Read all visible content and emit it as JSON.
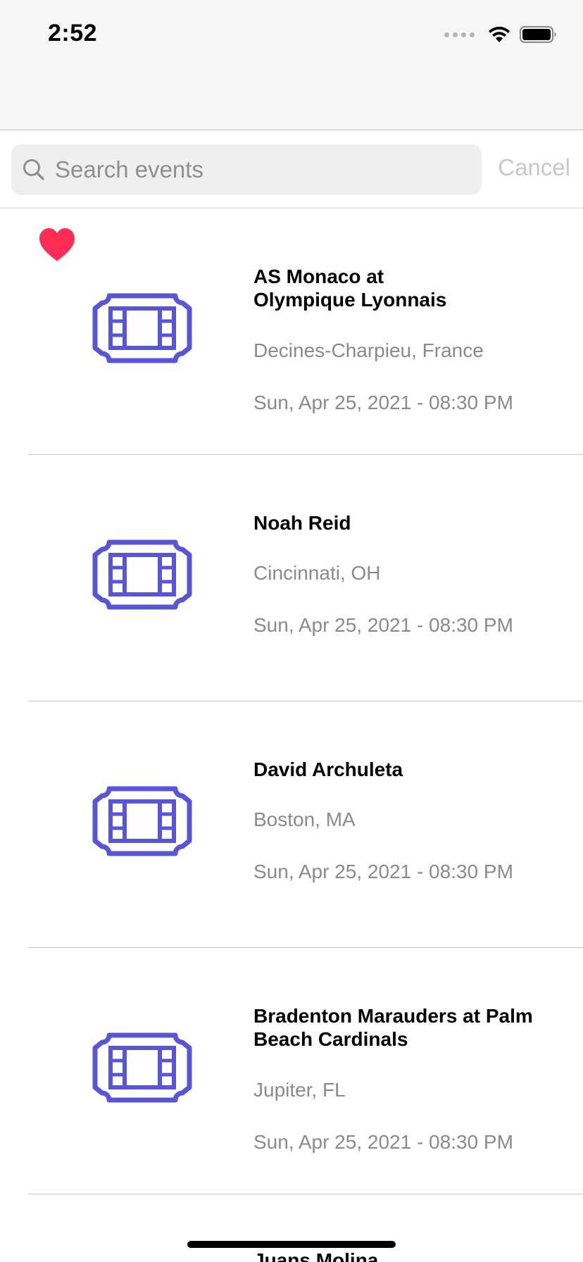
{
  "status_bar": {
    "time": "2:52"
  },
  "search": {
    "placeholder": "Search events",
    "value": "",
    "cancel_label": "Cancel"
  },
  "colors": {
    "accent": "#5856D6",
    "favorite": "#FF2D55"
  },
  "events": [
    {
      "title_line1": "AS Monaco at",
      "title_line2": "Olympique Lyonnais",
      "location": "Decines-Charpieu, France",
      "date": "Sun, Apr 25, 2021 - 08:30 PM",
      "favorited": true,
      "icon": "ticket-icon"
    },
    {
      "title_line1": "Noah Reid",
      "title_line2": "",
      "location": "Cincinnati, OH",
      "date": "Sun, Apr 25, 2021 - 08:30 PM",
      "favorited": false,
      "icon": "ticket-icon"
    },
    {
      "title_line1": "David Archuleta",
      "title_line2": "",
      "location": "Boston, MA",
      "date": "Sun, Apr 25, 2021 - 08:30 PM",
      "favorited": false,
      "icon": "ticket-icon"
    },
    {
      "title_line1": "Bradenton Marauders at Palm",
      "title_line2": "Beach Cardinals",
      "location": "Jupiter, FL",
      "date": "Sun, Apr 25, 2021 - 08:30 PM",
      "favorited": false,
      "icon": "ticket-icon"
    },
    {
      "title_line1": "Juans Molina",
      "title_line2": "",
      "location": "",
      "date": "",
      "favorited": false,
      "icon": "ticket-icon"
    }
  ]
}
